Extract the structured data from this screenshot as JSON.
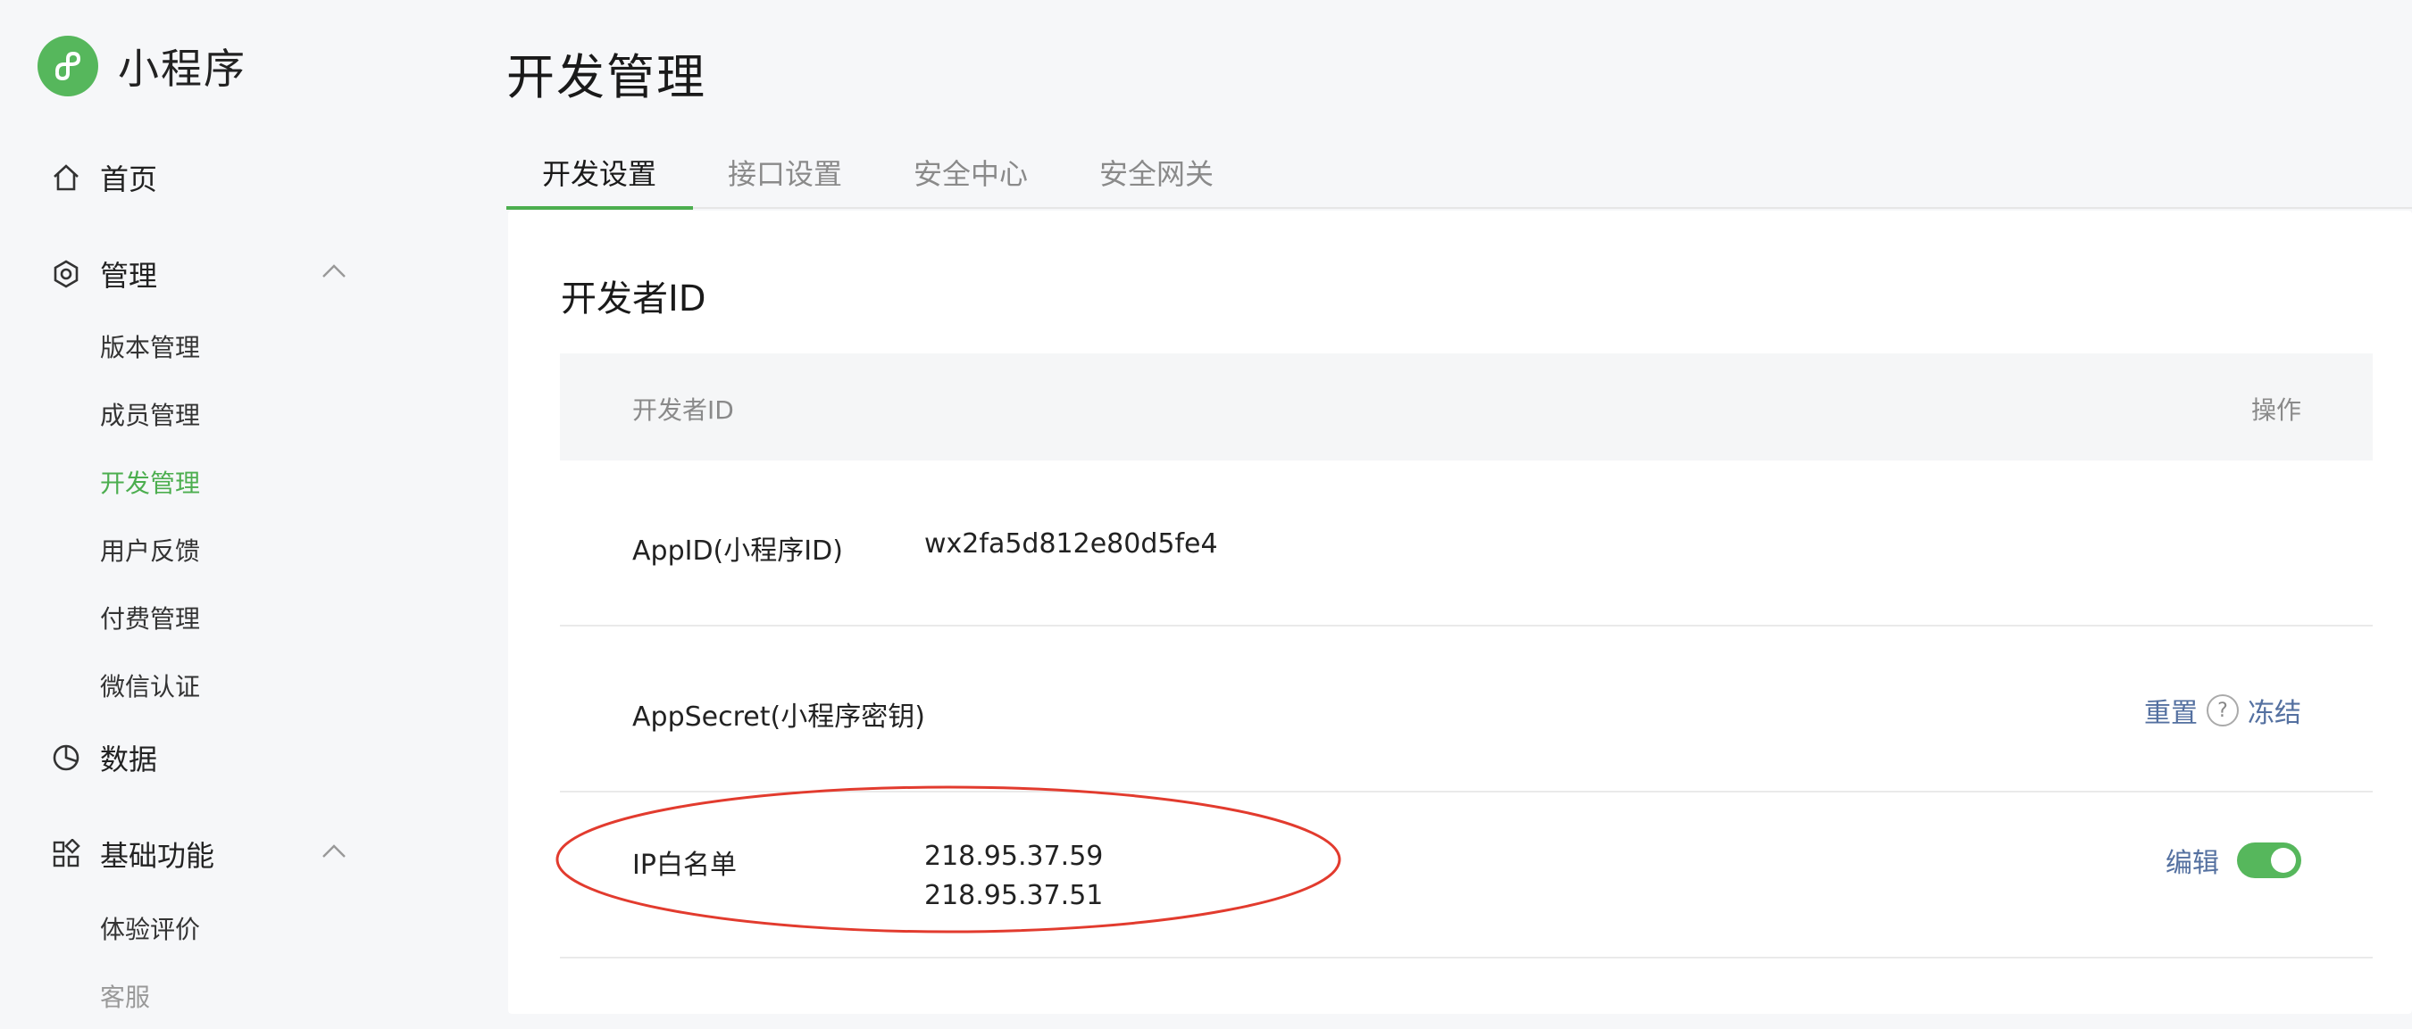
{
  "brand": {
    "title": "小程序"
  },
  "sidebar": {
    "home": "首页",
    "manage": "管理",
    "manage_items": [
      "版本管理",
      "成员管理",
      "开发管理",
      "用户反馈",
      "付费管理",
      "微信认证"
    ],
    "data": "数据",
    "basic": "基础功能",
    "basic_items": [
      "体验评价",
      "客服"
    ]
  },
  "page": {
    "title": "开发管理"
  },
  "tabs": [
    "开发设置",
    "接口设置",
    "安全中心",
    "安全网关"
  ],
  "section": {
    "title": "开发者ID"
  },
  "table": {
    "headers": {
      "id": "开发者ID",
      "action": "操作"
    },
    "rows": {
      "appid": {
        "label": "AppID(小程序ID)",
        "value": "wx2fa5d812e80d5fe4"
      },
      "appsecret": {
        "label": "AppSecret(小程序密钥)",
        "reset": "重置",
        "help": "?",
        "freeze": "冻结"
      },
      "ip": {
        "label": "IP白名单",
        "ips": [
          "218.95.37.59",
          "218.95.37.51"
        ],
        "edit": "编辑",
        "toggle_on": true
      }
    }
  },
  "colors": {
    "accent": "#4cae4f",
    "link": "#5470a0",
    "highlight": "#e23b2e"
  }
}
